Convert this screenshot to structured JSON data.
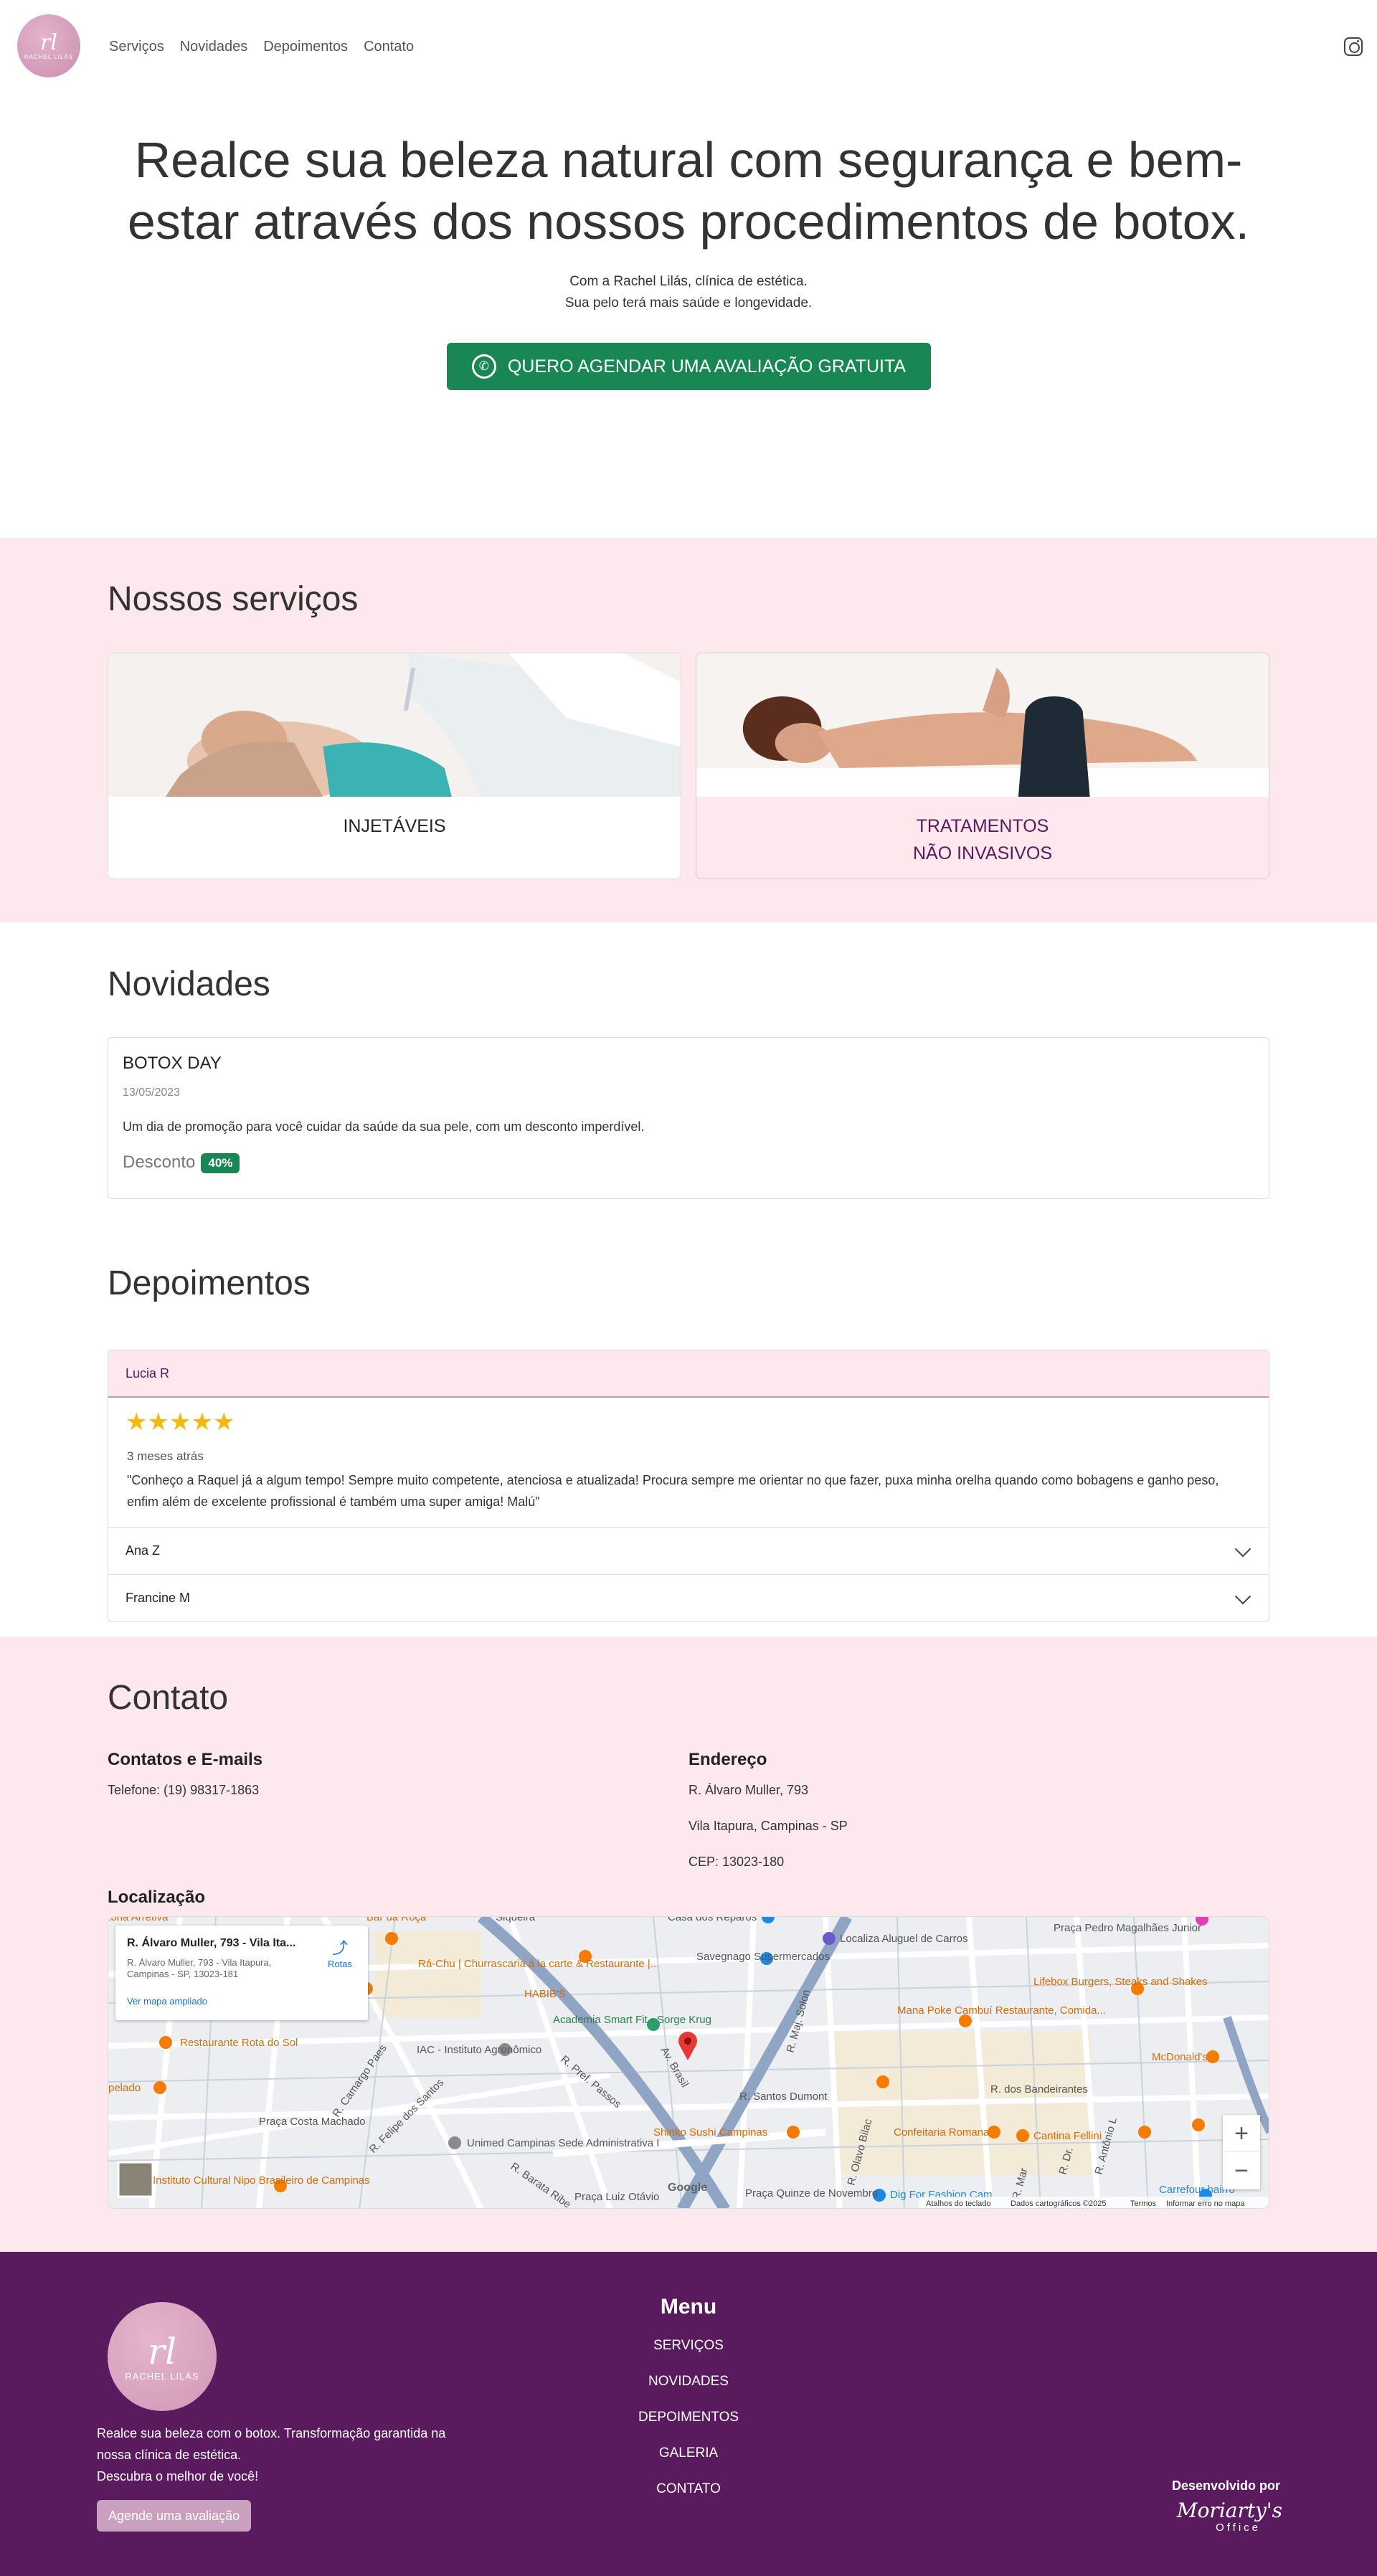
{
  "nav": {
    "logo_mono": "rl",
    "logo_name": "RACHEL LILÁS",
    "links": [
      "Serviços",
      "Novidades",
      "Depoimentos",
      "Contato"
    ],
    "instagram_icon": "instagram-icon"
  },
  "hero": {
    "title": "Realce sua beleza natural com segurança e bem-estar através dos nossos procedimentos de botox.",
    "sub1": "Com a Rachel Lilás, clínica de estética.",
    "sub2": "Sua pelo terá mais saúde e longevidade.",
    "cta": "QUERO AGENDAR UMA AVALIAÇÃO GRATUITA"
  },
  "services": {
    "title": "Nossos serviços",
    "items": [
      {
        "label": "INJETÁVEIS"
      },
      {
        "label1": "TRATAMENTOS",
        "label2": "NÃO INVASIVOS"
      }
    ]
  },
  "news": {
    "title": "Novidades",
    "card": {
      "title": "BOTOX DAY",
      "date": "13/05/2023",
      "text": "Um dia de promoção para você cuidar da saúde da sua pele, com um desconto imperdível.",
      "discount_label": "Desconto",
      "discount_value": "40%"
    }
  },
  "testimonials": {
    "title": "Depoimentos",
    "open": {
      "name": "Lucia R",
      "rating": 5,
      "when": "3 meses atrás",
      "text": "\"Conheço a Raquel já a algum tempo! Sempre muito competente, atenciosa e atualizada! Procura sempre me orientar no que fazer, puxa minha orelha quando como bobagens e ganho peso, enfim além de excelente profissional é também uma super amiga! Malú\""
    },
    "collapsed": [
      "Ana Z",
      "Francine M"
    ]
  },
  "contact": {
    "title": "Contato",
    "emails_title": "Contatos e E-mails",
    "phone": "Telefone: (19) 98317-1863",
    "address_title": "Endereço",
    "address1": "R. Álvaro Muller, 793",
    "address2": "Vila Itapura, Campinas - SP",
    "address3": "CEP: 13023-180",
    "location_title": "Localização"
  },
  "map": {
    "card_title": "R. Álvaro Muller, 793 - Vila Ita...",
    "card_addr1": "R. Álvaro Muller, 793 - Vila Itapura,",
    "card_addr2": "Campinas - SP, 13023-181",
    "card_link": "Ver mapa ampliado",
    "directions": "Rotas",
    "labels": {
      "habibs": "HABIB'S",
      "academia": "Academia Smart Fit - Sorge Krug",
      "savegnago": "Savegnago Supermercados",
      "localiza": "Localiza Aluguel de Carros",
      "casa": "Casa dos Reparos",
      "pedro": "Praça Pedro Magalhães Junior",
      "lifebox": "Lifebox Burgers, Steaks and Shakes",
      "mana": "Mana Poke Cambuí Restaurante, Comida...",
      "mcdonalds": "McDonald's",
      "bandeirantes": "R. dos Bandeirantes",
      "santos": "R. Santos Dumont",
      "conf_romana": "Confeitaria Romana",
      "cantina": "Cantina Fellini",
      "shinko": "Shinko Sushi Campinas",
      "iac": "IAC - Instituto Agronômico",
      "rachu": "Rá-Chu | Churrascaria à la carte & Restaurante |...",
      "rota": "Restaurante Rota do Sol",
      "praca_costa": "Praça Costa Machado",
      "unimed": "Unimed Campinas Sede Administrativa I",
      "instituto": "Instituto Cultural Nipo Brasileiro de Campinas",
      "praca_luiz": "Praça Luiz Otávio",
      "praca_quinze": "Praça Quinze de Novembro",
      "dig": "Dig For Fashion Cam",
      "carrefour": "Carrefour bairro",
      "siqueira": "Siqueira",
      "av_brasil": "Av. Brasil",
      "pelado": "pelado",
      "arretiva": "loria Arretiva",
      "bar_roca": "Bar da Roça",
      "camargo": "R. Camargo Paes",
      "felipe": "R. Felipe dos Santos",
      "passos": "R. Pref. Passos",
      "barata": "R. Barata Ribe",
      "solon": "R. Maj. Solon",
      "olavo": "R. Olavo Bilac",
      "dr": "R. Dr.",
      "antonio": "R. Antônio L",
      "mar": "R. Mar",
      "google": "Google",
      "atalhos": "Atalhos do teclado",
      "dados": "Dados cartográficos ©2025",
      "termos": "Termos",
      "erro": "Informar erro no mapa"
    }
  },
  "footer": {
    "logo_mono": "rl",
    "logo_name": "RACHEL LILÁS",
    "text1": "Realce sua beleza com o botox. Transformação garantida na",
    "text2": "nossa clínica de estética.",
    "text3": "Descubra o melhor de você!",
    "cta": "Agende uma avaliação",
    "menu_title": "Menu",
    "menu": [
      "SERVIÇOS",
      "NOVIDADES",
      "DEPOIMENTOS",
      "GALERIA",
      "CONTATO"
    ],
    "dev_label": "Desenvolvido por",
    "dev_name": "Moriarty's",
    "dev_sub": "Office"
  },
  "colors": {
    "accent_green": "#198754",
    "pink_band": "#fde8ee",
    "footer_purple": "#5a1a5e",
    "brand_pink": "#cf98b6"
  }
}
